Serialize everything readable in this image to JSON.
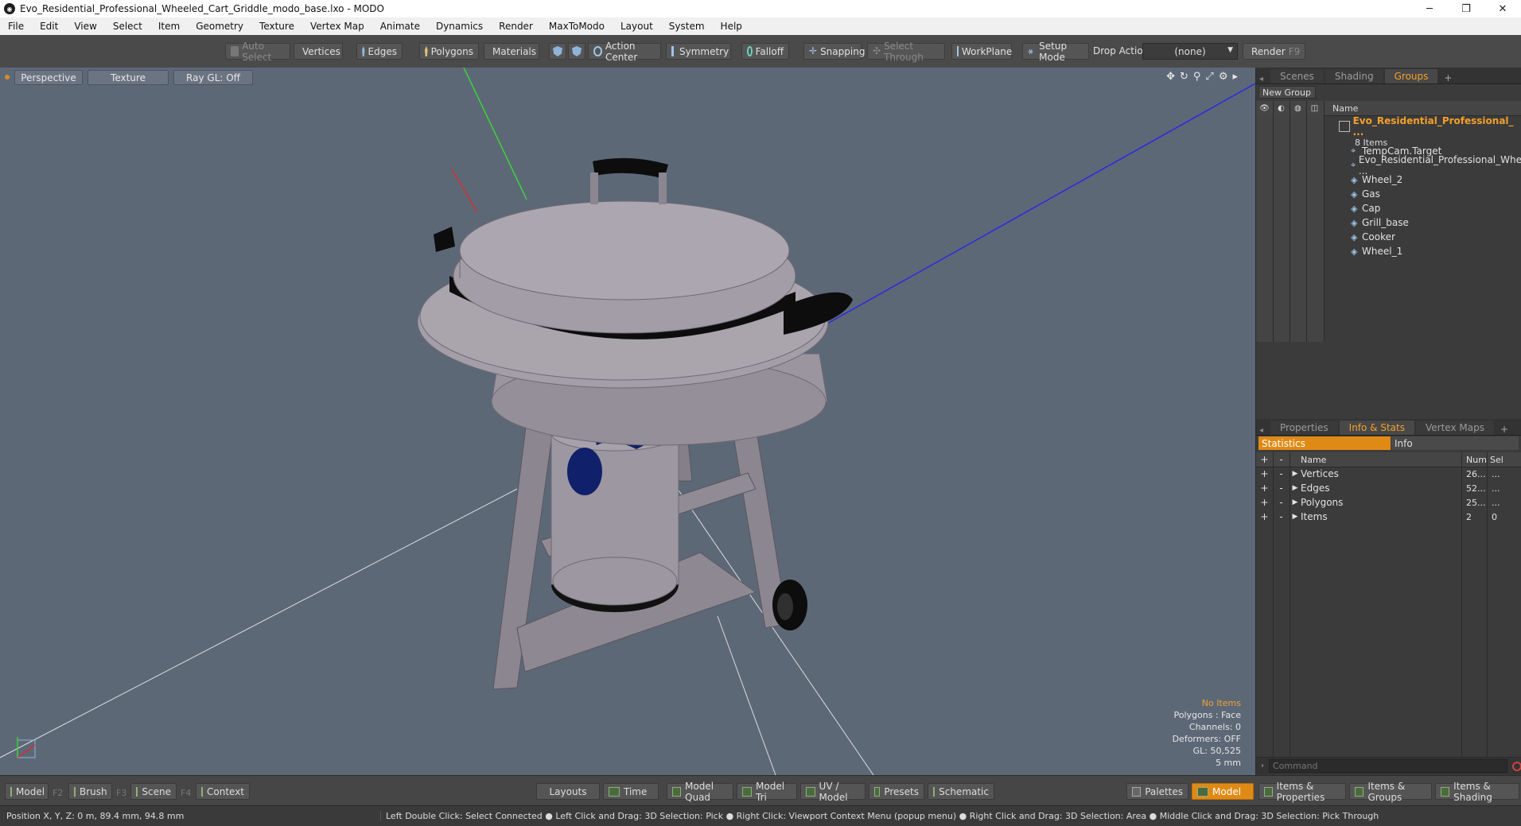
{
  "window": {
    "title": "Evo_Residential_Professional_Wheeled_Cart_Griddle_modo_base.lxo - MODO"
  },
  "menu": [
    "File",
    "Edit",
    "View",
    "Select",
    "Item",
    "Geometry",
    "Texture",
    "Vertex Map",
    "Animate",
    "Dynamics",
    "Render",
    "MaxToModo",
    "Layout",
    "System",
    "Help"
  ],
  "toolbar": {
    "auto_select": "Auto Select",
    "vertices": "Vertices",
    "edges": "Edges",
    "polygons": "Polygons",
    "materials": "Materials",
    "action_center": "Action Center",
    "symmetry": "Symmetry",
    "falloff": "Falloff",
    "snapping": "Snapping",
    "select_through": "Select Through",
    "workplane": "WorkPlane",
    "setup_mode": "Setup Mode",
    "drop_action": "Drop Action",
    "drop_value": "(none)",
    "render": "Render",
    "render_key": "F9"
  },
  "viewport": {
    "tabs": [
      "Perspective",
      "Texture",
      "Ray GL: Off"
    ],
    "stats": {
      "items": "No Items",
      "polygons": "Polygons : Face",
      "channels": "Channels: 0",
      "deformers": "Deformers: OFF",
      "gl": "GL: 50,525",
      "scale": "5 mm"
    }
  },
  "scene_panel": {
    "tabs": [
      "Scenes",
      "Shading",
      "Groups"
    ],
    "new_group": "New Group",
    "col_name": "Name",
    "group_name": "Evo_Residential_Professional_ ...",
    "group_count": "8 Items",
    "items": [
      "TempCam.Target",
      "Evo_Residential_Professional_Whe ...",
      "Wheel_2",
      "Gas",
      "Cap",
      "Grill_base",
      "Cooker",
      "Wheel_1"
    ]
  },
  "info_panel": {
    "tabs": [
      "Properties",
      "Info & Stats",
      "Vertex Maps"
    ],
    "subtabs": [
      "Statistics",
      "Info"
    ],
    "cols": {
      "name": "Name",
      "num": "Num",
      "sel": "Sel"
    },
    "rows": [
      {
        "name": "Vertices",
        "num": "26...",
        "sel": "..."
      },
      {
        "name": "Edges",
        "num": "52...",
        "sel": "..."
      },
      {
        "name": "Polygons",
        "num": "25...",
        "sel": "..."
      },
      {
        "name": "Items",
        "num": "2",
        "sel": "0"
      }
    ],
    "command_placeholder": "Command"
  },
  "bottombar": {
    "model": "Model",
    "model_key": "F2",
    "brush": "Brush",
    "brush_key": "F3",
    "scene": "Scene",
    "scene_key": "F4",
    "context": "Context",
    "layouts": "Layouts",
    "time": "Time",
    "model_quad": "Model Quad",
    "model_tri": "Model Tri",
    "uv_model": "UV / Model",
    "presets": "Presets",
    "schematic": "Schematic",
    "palettes": "Palettes",
    "model_active": "Model",
    "items_properties": "Items & Properties",
    "items_groups": "Items & Groups",
    "items_shading": "Items & Shading"
  },
  "statusbar": {
    "position": "Position X, Y, Z:   0 m, 89.4 mm, 94.8 mm",
    "hints": "Left Double Click: Select Connected ● Left Click and Drag: 3D Selection: Pick ● Right Click: Viewport Context Menu (popup menu) ● Right Click and Drag: 3D Selection: Area ● Middle Click and Drag: 3D Selection: Pick Through"
  },
  "colors": {
    "accent": "#f3a02a",
    "viewport_bg": "#5d6877",
    "panel_bg": "#3b3b3b"
  }
}
